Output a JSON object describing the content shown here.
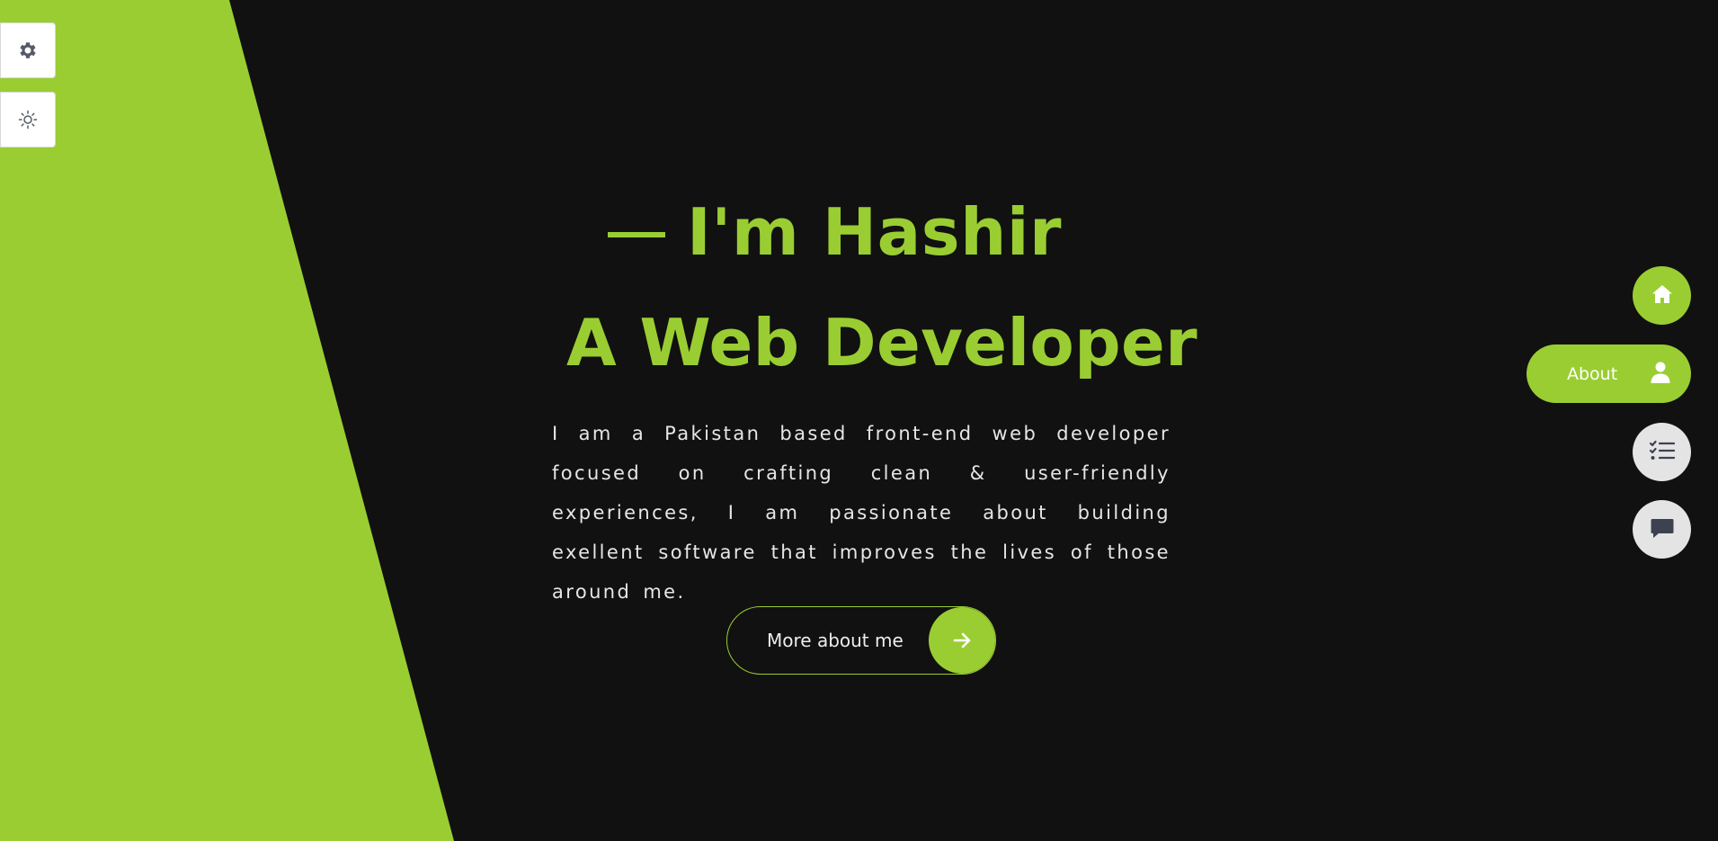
{
  "colors": {
    "accent": "#9acd32",
    "background": "#111111",
    "text_light": "#e6e6e6",
    "button_light": "#ffffff",
    "nav_inactive": "#e4e4e4",
    "icon_dark": "#555b66"
  },
  "toolbar": {
    "settings_icon": "gear-icon",
    "theme_icon": "sun-icon"
  },
  "hero": {
    "greeting": "I'm Hashir",
    "role": "A Web Developer",
    "bio": "I am a Pakistan based front-end web developer focused on crafting clean & user-friendly experiences, I am passionate about building exellent software that improves the lives of those around me.",
    "cta_label": "More about me",
    "cta_icon": "arrow-right-icon"
  },
  "nav": {
    "items": [
      {
        "icon": "home-icon",
        "label": "",
        "active": false
      },
      {
        "icon": "user-icon",
        "label": "About",
        "active": true
      },
      {
        "icon": "list-check-icon",
        "label": "",
        "active": false
      },
      {
        "icon": "chat-icon",
        "label": "",
        "active": false
      }
    ]
  }
}
